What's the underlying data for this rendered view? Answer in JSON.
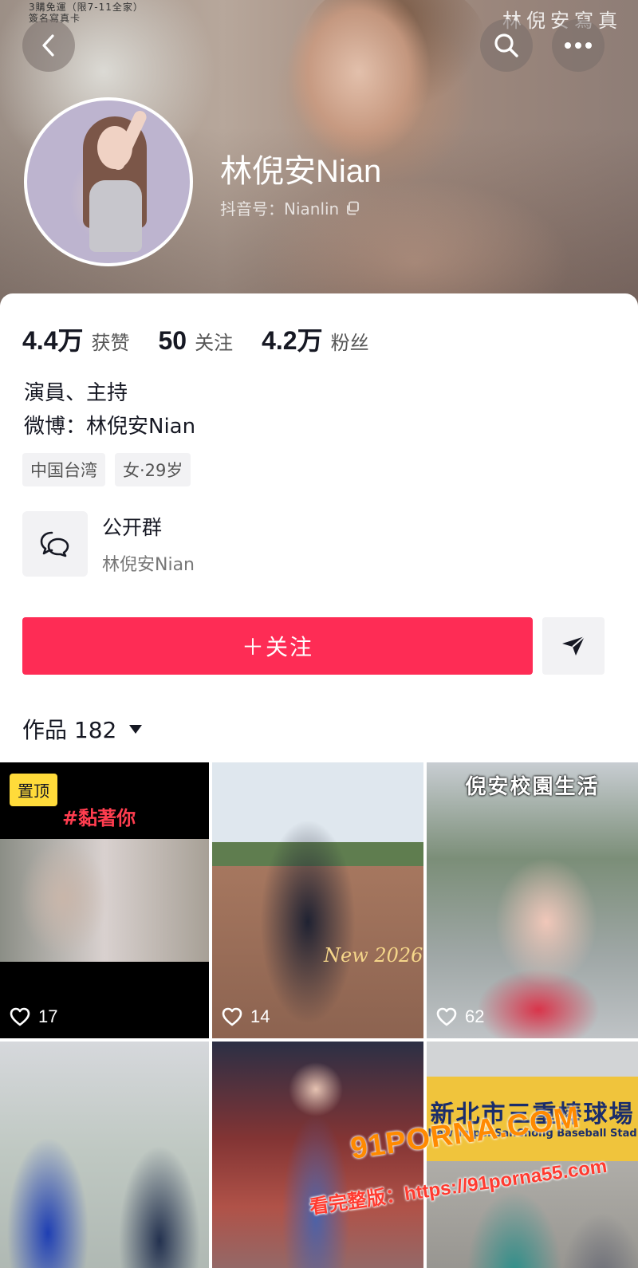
{
  "cover": {
    "top_left_text": "3購免運（限7-11全家）\n簽名寫真卡",
    "top_right_text": "林倪安寫真"
  },
  "profile": {
    "name": "林倪安Nian",
    "douyin_id": "抖音号：Nianlin"
  },
  "stats": [
    {
      "value": "4.4万",
      "label": "获赞"
    },
    {
      "value": "50",
      "label": "关注"
    },
    {
      "value": "4.2万",
      "label": "粉丝"
    }
  ],
  "bio": {
    "line1": "演員、主持",
    "line2": "微博：林倪安Nian"
  },
  "tags": [
    "中国台湾",
    "女·29岁"
  ],
  "group": {
    "title": "公开群",
    "subtitle": "林倪安Nian"
  },
  "actions": {
    "follow_label": "＋关注"
  },
  "works": {
    "label": "作品 182"
  },
  "videos": [
    {
      "likes": "17",
      "pinned_label": "置顶",
      "caption": "#黏著你"
    },
    {
      "likes": "14",
      "script": "New 2026"
    },
    {
      "likes": "62",
      "overlay": "倪安校園生活"
    },
    {
      "likes": ""
    },
    {
      "likes": ""
    },
    {
      "likes": "",
      "sign": "新北市三重棒球場",
      "sign_sub": "New Taipei SanChong Baseball Stad"
    }
  ],
  "watermark": {
    "logo": "91PORNA.COM",
    "text": "看完整版：https://91porna55.com"
  },
  "colors": {
    "accent": "#fe2c55",
    "pin_badge": "#ffdb3a"
  },
  "icons": [
    "back-icon",
    "search-icon",
    "more-icon",
    "copy-icon",
    "chat-group-icon",
    "share-arrow-icon",
    "heart-icon",
    "caret-down-icon"
  ]
}
